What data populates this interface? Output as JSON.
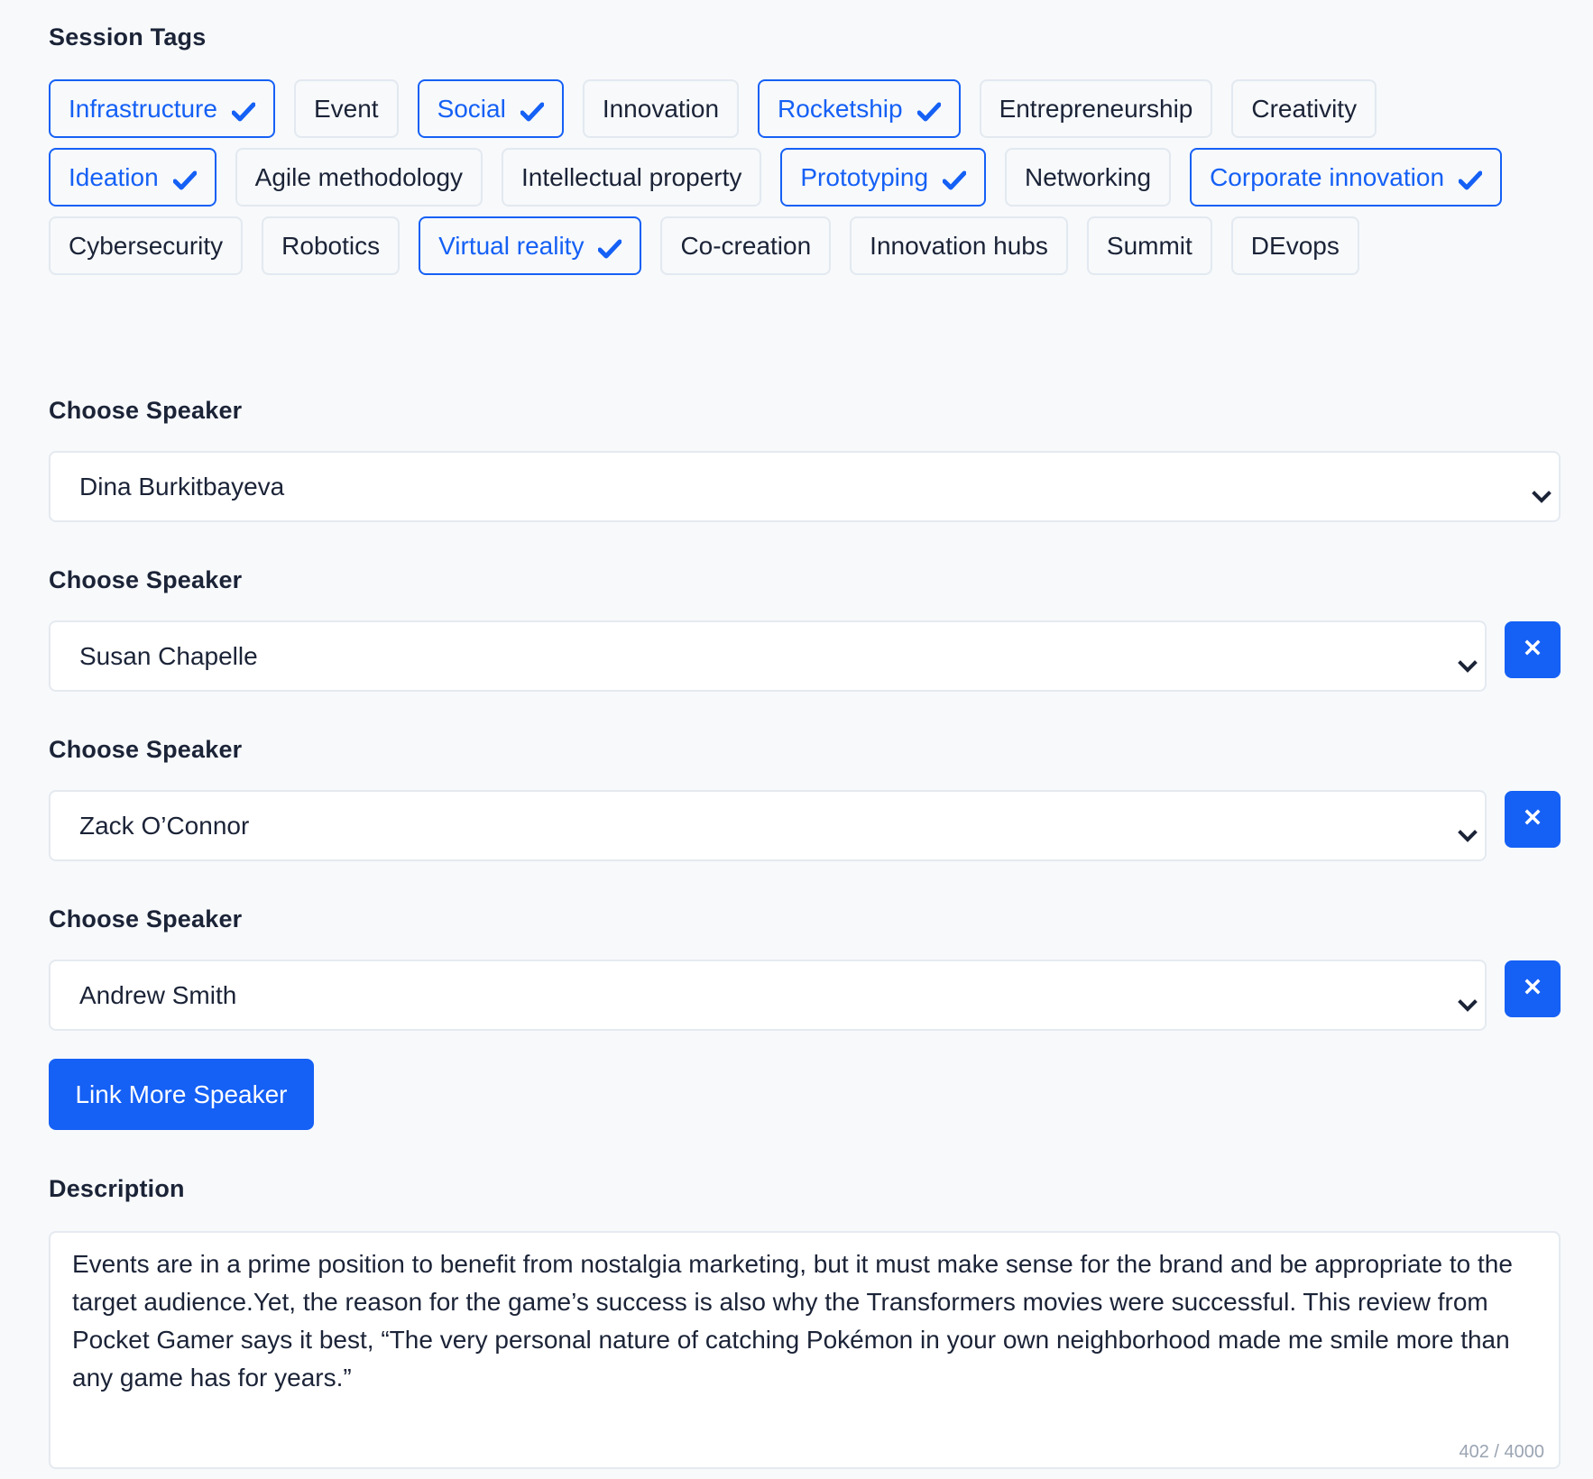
{
  "session_tags": {
    "label": "Session Tags",
    "tags": [
      {
        "label": "Infrastructure",
        "selected": true
      },
      {
        "label": "Event",
        "selected": false
      },
      {
        "label": "Social",
        "selected": true
      },
      {
        "label": "Innovation",
        "selected": false
      },
      {
        "label": "Rocketship",
        "selected": true
      },
      {
        "label": "Entrepreneurship",
        "selected": false
      },
      {
        "label": "Creativity",
        "selected": false
      },
      {
        "label": "Ideation",
        "selected": true
      },
      {
        "label": "Agile methodology",
        "selected": false
      },
      {
        "label": "Intellectual property",
        "selected": false
      },
      {
        "label": "Prototyping",
        "selected": true
      },
      {
        "label": "Networking",
        "selected": false
      },
      {
        "label": "Corporate innovation",
        "selected": true
      },
      {
        "label": "Cybersecurity",
        "selected": false
      },
      {
        "label": "Robotics",
        "selected": false
      },
      {
        "label": "Virtual reality",
        "selected": true
      },
      {
        "label": "Co-creation",
        "selected": false
      },
      {
        "label": "Innovation hubs",
        "selected": false
      },
      {
        "label": "Summit",
        "selected": false
      },
      {
        "label": "DEvops",
        "selected": false
      }
    ]
  },
  "speakers": [
    {
      "label": "Choose Speaker",
      "value": "Dina Burkitbayeva",
      "removable": false
    },
    {
      "label": "Choose Speaker",
      "value": "Susan Chapelle",
      "removable": true
    },
    {
      "label": "Choose Speaker",
      "value": "Zack O’Connor",
      "removable": true
    },
    {
      "label": "Choose Speaker",
      "value": "Andrew Smith",
      "removable": true
    }
  ],
  "icons": {
    "tag_selected": "check-icon",
    "select": "chevron-down-icon",
    "remove": "close-icon"
  },
  "link_more_button": "Link More Speaker",
  "description": {
    "label": "Description",
    "value": "Events are in a prime position to benefit from nostalgia marketing, but it must make sense for the brand and be appropriate to the target audience.Yet, the reason for the game’s success is also why the Transformers movies were successful. This review from Pocket Gamer says it best, “The very personal nature of catching Pokémon in your own neighborhood made me smile more than any game has for years.”",
    "counter": "402 / 4000"
  },
  "colors": {
    "accent": "#1560f5",
    "text": "#1b2337",
    "border": "#e3e9f0",
    "background": "#f7f9fb",
    "muted": "#9aa4b2"
  }
}
